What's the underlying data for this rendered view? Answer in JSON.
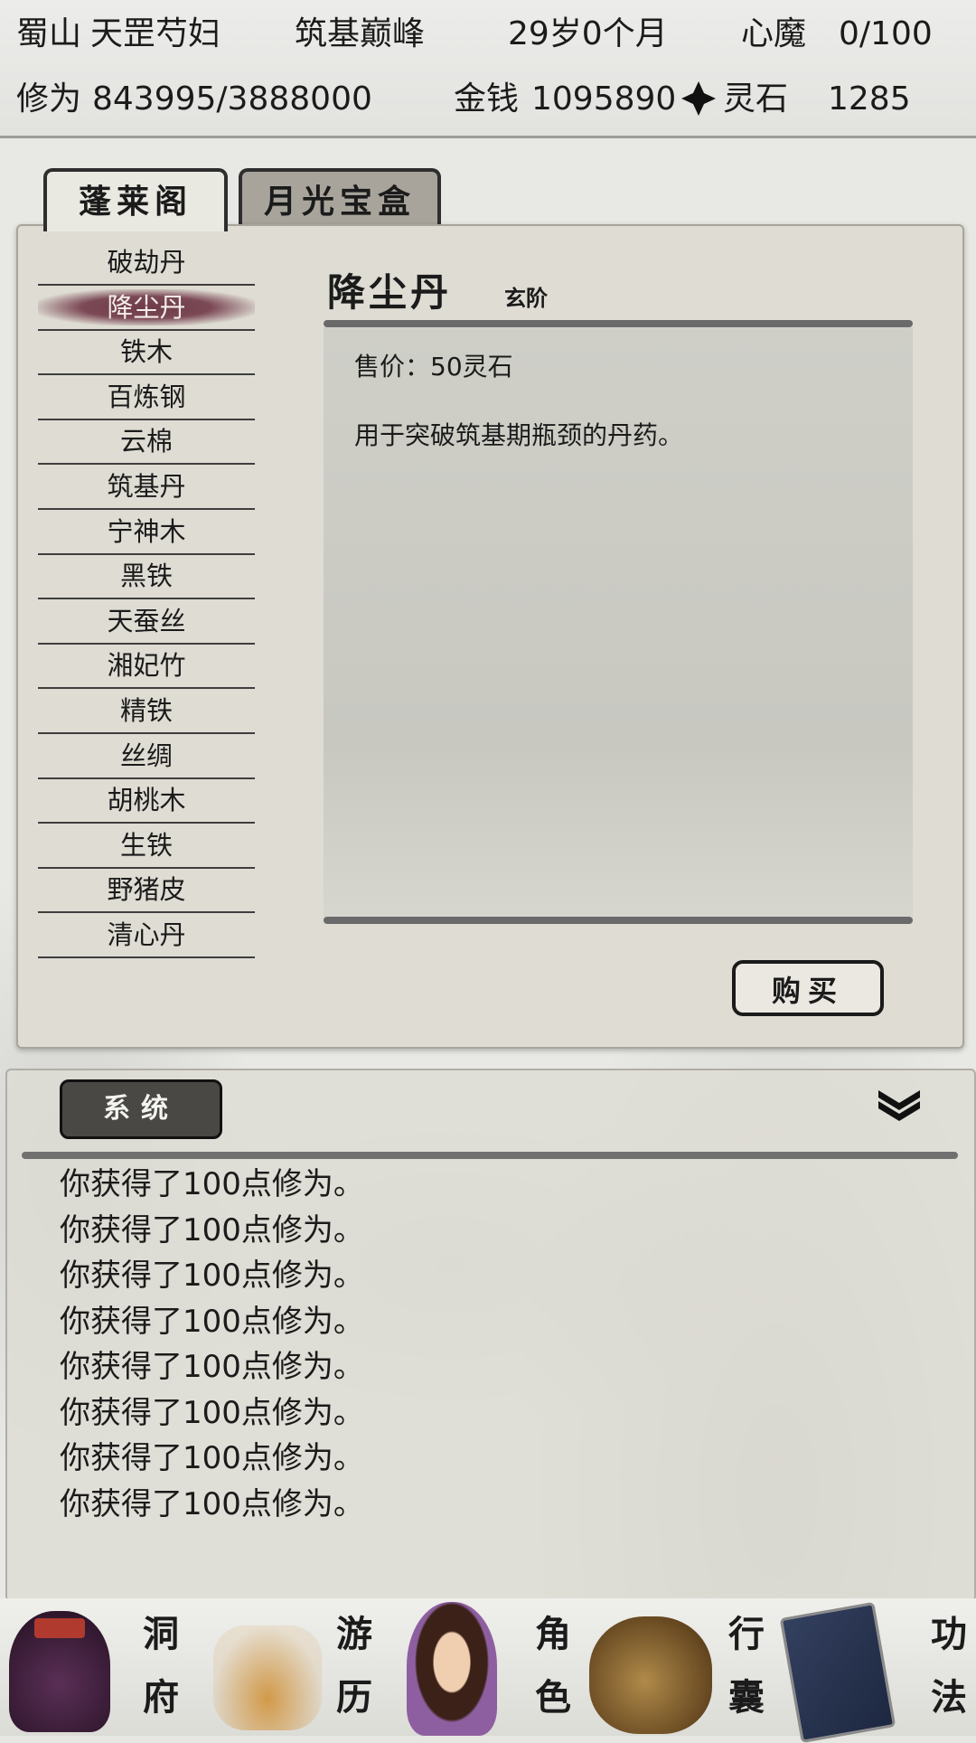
{
  "status": {
    "location": "蜀山",
    "name": "天罡芍妇",
    "realm": "筑基巅峰",
    "age": "29岁0个月",
    "heart_demon_label": "心魔",
    "heart_demon_value": "0/100",
    "cultivation_label": "修为",
    "cultivation_value": "843995/3888000",
    "money_label": "金钱",
    "money_value": "1095890",
    "spirit_stone_label": "灵石",
    "spirit_stone_value": "1285"
  },
  "tabs": [
    "蓬莱阁",
    "月光宝盒"
  ],
  "shop": {
    "items": [
      "破劫丹",
      "降尘丹",
      "铁木",
      "百炼钢",
      "云棉",
      "筑基丹",
      "宁神木",
      "黑铁",
      "天蚕丝",
      "湘妃竹",
      "精铁",
      "丝绸",
      "胡桃木",
      "生铁",
      "野猪皮",
      "清心丹"
    ],
    "selected_index": 1,
    "detail": {
      "name": "降尘丹",
      "grade": "玄阶",
      "price": "售价：50灵石",
      "description": "用于突破筑基期瓶颈的丹药。"
    },
    "buy_label": "购买"
  },
  "log": {
    "tab_label": "系统",
    "messages": [
      "你获得了100点修为。",
      "你获得了100点修为。",
      "你获得了100点修为。",
      "你获得了100点修为。",
      "你获得了100点修为。",
      "你获得了100点修为。",
      "你获得了100点修为。",
      "你获得了100点修为。"
    ]
  },
  "nav": {
    "cave": "洞府",
    "travel": "游历",
    "character": "角色",
    "bag": "行囊",
    "skills": "功法"
  },
  "icons": {
    "spirit_stone": "spirit-stone-icon",
    "collapse": "double-chevron-down-icon"
  }
}
